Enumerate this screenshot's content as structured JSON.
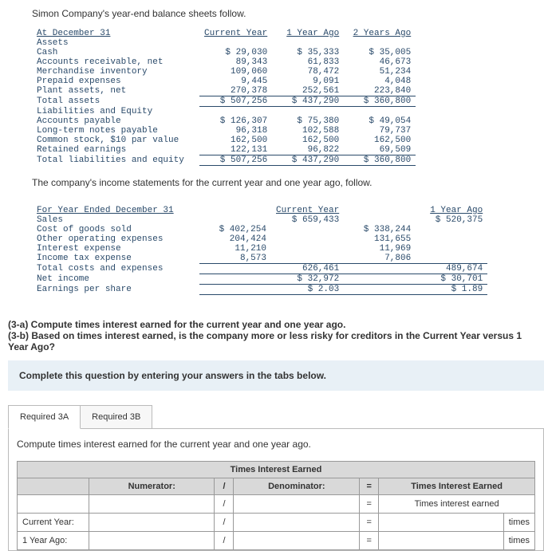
{
  "intro": "Simon Company's year-end balance sheets follow.",
  "bs": {
    "dateRow": "At December 31",
    "cols": [
      "Current Year",
      "1 Year Ago",
      "2 Years Ago"
    ],
    "assetsHdr": "Assets",
    "rows": [
      {
        "label": "Cash",
        "v": [
          "$ 29,030",
          "$ 35,333",
          "$ 35,005"
        ]
      },
      {
        "label": "Accounts receivable, net",
        "v": [
          "89,343",
          "61,833",
          "46,673"
        ]
      },
      {
        "label": "Merchandise inventory",
        "v": [
          "109,060",
          "78,472",
          "51,234"
        ]
      },
      {
        "label": "Prepaid expenses",
        "v": [
          "9,445",
          "9,091",
          "4,048"
        ]
      },
      {
        "label": "Plant assets, net",
        "v": [
          "270,378",
          "252,561",
          "223,840"
        ]
      }
    ],
    "totalAssets": {
      "label": "Total assets",
      "v": [
        "$ 507,256",
        "$ 437,290",
        "$ 360,800"
      ]
    },
    "leHdr": "Liabilities and Equity",
    "leRows": [
      {
        "label": "Accounts payable",
        "v": [
          "$ 126,307",
          "$ 75,380",
          "$ 49,054"
        ]
      },
      {
        "label": "Long-term notes payable",
        "v": [
          "96,318",
          "102,588",
          "79,737"
        ]
      },
      {
        "label": "Common stock, $10 par value",
        "v": [
          "162,500",
          "162,500",
          "162,500"
        ]
      },
      {
        "label": "Retained earnings",
        "v": [
          "122,131",
          "96,822",
          "69,509"
        ]
      }
    ],
    "totalLE": {
      "label": "Total liabilities and equity",
      "v": [
        "$ 507,256",
        "$ 437,290",
        "$ 360,800"
      ]
    }
  },
  "narr": "The company's income statements for the current year and one year ago, follow.",
  "is": {
    "dateRow": "For Year Ended December 31",
    "cols": [
      "Current Year",
      "1 Year Ago"
    ],
    "sales": {
      "label": "Sales",
      "v": [
        "$ 659,433",
        "$ 520,375"
      ]
    },
    "costs": [
      {
        "label": "Cost of goods sold",
        "v": [
          "$ 402,254",
          "$ 338,244"
        ]
      },
      {
        "label": "Other operating expenses",
        "v": [
          "204,424",
          "131,655"
        ]
      },
      {
        "label": "Interest expense",
        "v": [
          "11,210",
          "11,969"
        ]
      },
      {
        "label": "Income tax expense",
        "v": [
          "8,573",
          "7,806"
        ]
      }
    ],
    "totCosts": {
      "label": "Total costs and expenses",
      "v": [
        "626,461",
        "489,674"
      ]
    },
    "netInc": {
      "label": "Net income",
      "v": [
        "$ 32,972",
        "$ 30,701"
      ]
    },
    "eps": {
      "label": "Earnings per share",
      "v": [
        "$ 2.03",
        "$ 1.89"
      ]
    }
  },
  "question": {
    "a": "(3-a) Compute times interest earned for the current year and one year ago.",
    "b": "(3-b) Based on times interest earned, is the company more or less risky for creditors in the Current Year versus 1 Year Ago?"
  },
  "instr": "Complete this question by entering your answers in the tabs below.",
  "tabs": {
    "a": "Required 3A",
    "b": "Required 3B"
  },
  "subinstr": "Compute times interest earned for the current year and one year ago.",
  "calc": {
    "title": "Times Interest Earned",
    "numerator": "Numerator:",
    "denominator": "Denominator:",
    "resultHdr": "Times Interest Earned",
    "resultSub": "Times interest earned",
    "rowCY": "Current Year:",
    "row1Y": "1 Year Ago:",
    "slash": "/",
    "eq": "=",
    "unit": "times"
  }
}
